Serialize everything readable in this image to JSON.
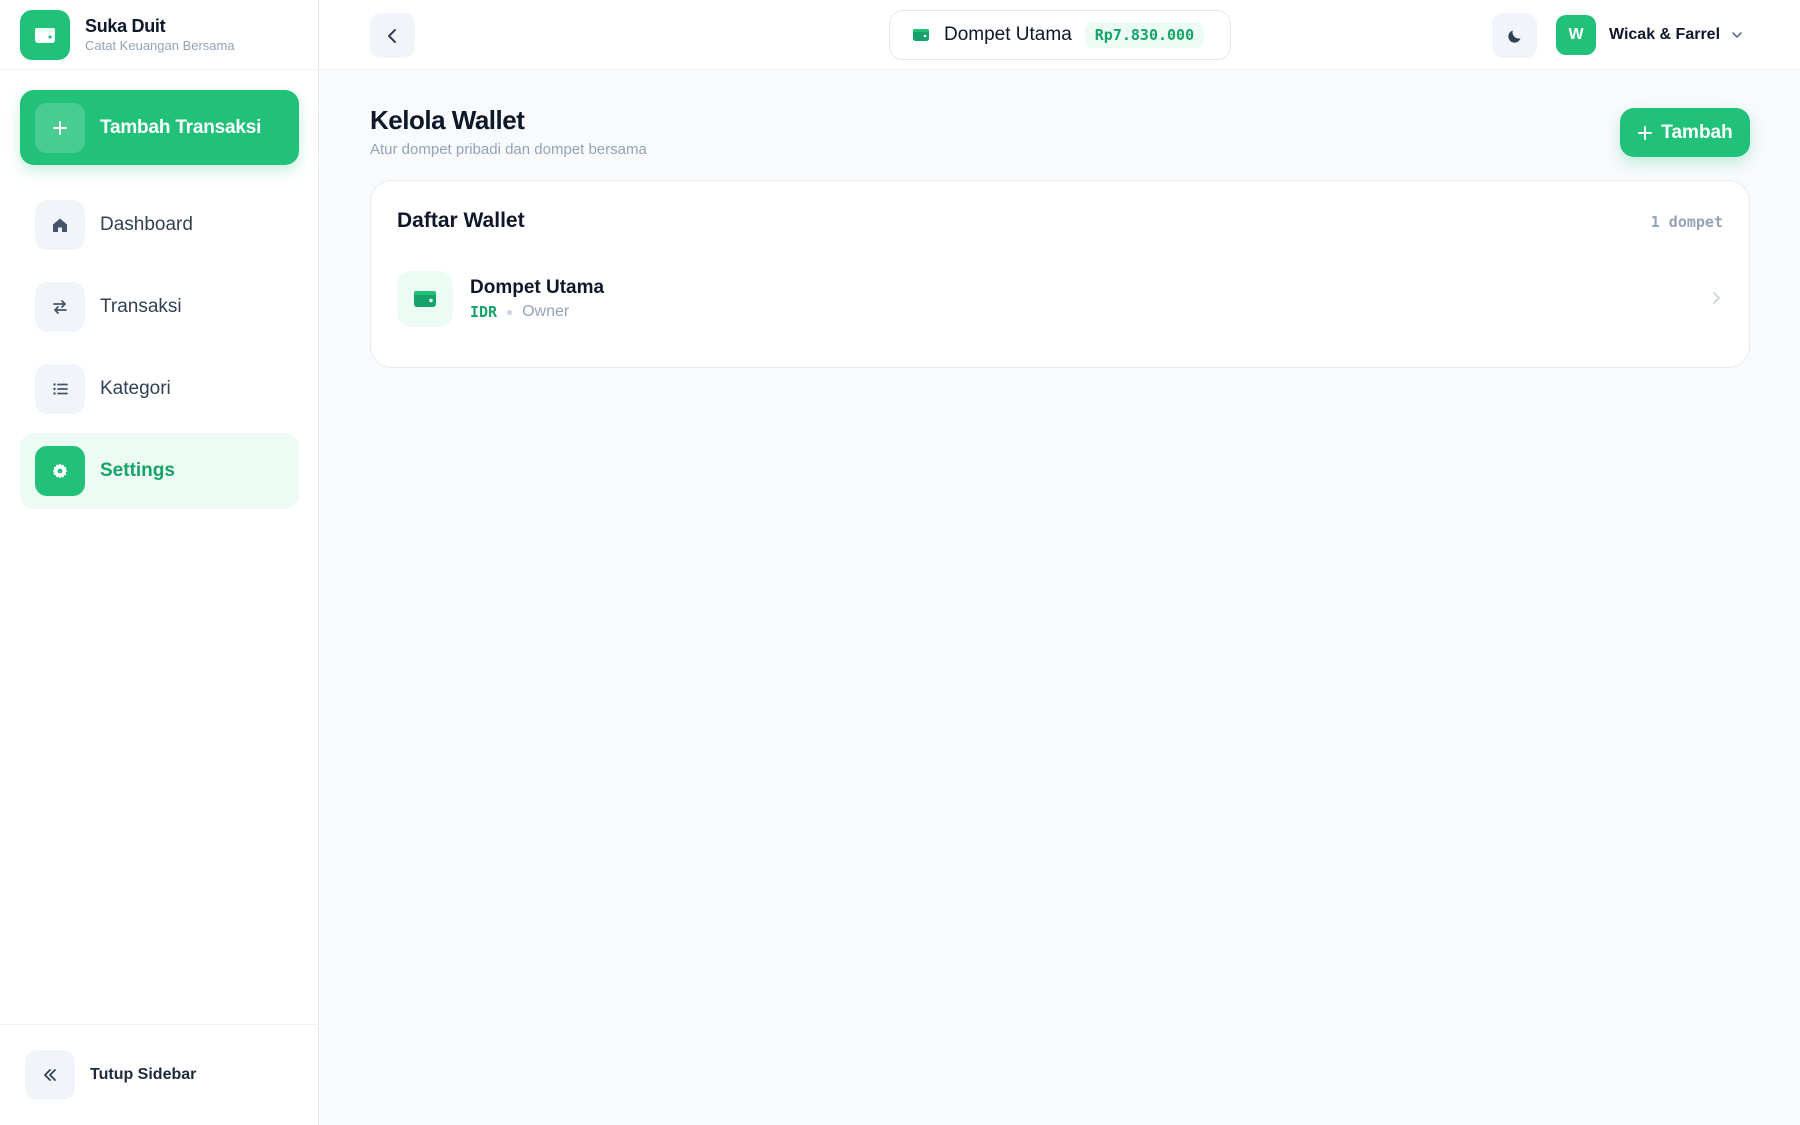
{
  "app": {
    "name": "Suka Duit",
    "tagline": "Catat Keuangan Bersama"
  },
  "sidebar": {
    "add_transaction_label": "Tambah Transaksi",
    "items": [
      {
        "label": "Dashboard",
        "icon": "home-icon"
      },
      {
        "label": "Transaksi",
        "icon": "swap-icon"
      },
      {
        "label": "Kategori",
        "icon": "list-icon"
      },
      {
        "label": "Settings",
        "icon": "gear-icon",
        "active": true
      }
    ],
    "collapse_label": "Tutup Sidebar"
  },
  "header": {
    "wallet_name": "Dompet Utama",
    "wallet_balance": "Rp7.830.000",
    "user_initial": "W",
    "user_name": "Wicak & Farrel"
  },
  "page": {
    "title": "Kelola Wallet",
    "subtitle": "Atur dompet pribadi dan dompet bersama",
    "add_button_label": "Tambah"
  },
  "wallet_list": {
    "title": "Daftar Wallet",
    "count_label": "1 dompet",
    "items": [
      {
        "name": "Dompet Utama",
        "currency": "IDR",
        "role": "Owner"
      }
    ]
  },
  "colors": {
    "accent": "#22c17a",
    "accent_dark": "#16a36a",
    "accent_soft": "#ecfbf3"
  }
}
